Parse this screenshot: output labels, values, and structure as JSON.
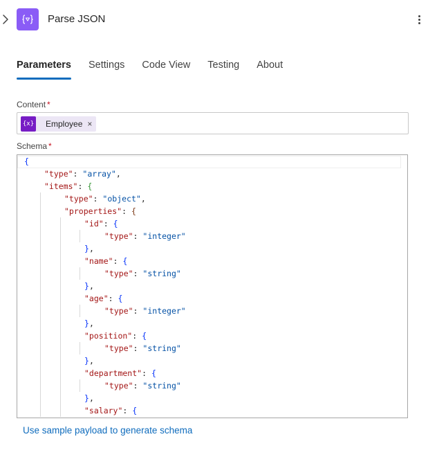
{
  "header": {
    "title": "Parse JSON",
    "icon_text": "{ }"
  },
  "tabs": [
    {
      "label": "Parameters",
      "active": true
    },
    {
      "label": "Settings",
      "active": false
    },
    {
      "label": "Code View",
      "active": false
    },
    {
      "label": "Testing",
      "active": false
    },
    {
      "label": "About",
      "active": false
    }
  ],
  "content": {
    "label": "Content",
    "required_mark": "*",
    "token": {
      "label": "Employee",
      "icon_text": "{x}",
      "remove_glyph": "×"
    }
  },
  "schema": {
    "label": "Schema",
    "required_mark": "*",
    "lines": [
      "{",
      "\"type\": \"array\",",
      "\"items\": {",
      "\"type\": \"object\",",
      "\"properties\": {",
      "\"id\": {",
      "\"type\": \"integer\"",
      "},",
      "\"name\": {",
      "\"type\": \"string\"",
      "},",
      "\"age\": {",
      "\"type\": \"integer\"",
      "},",
      "\"position\": {",
      "\"type\": \"string\"",
      "},",
      "\"department\": {",
      "\"type\": \"string\"",
      "},",
      "\"salary\": {"
    ]
  },
  "sample_link": "Use sample payload to generate schema",
  "colors": {
    "accent": "#0f6cbd",
    "action_icon": "#8a5cf6",
    "token_icon": "#771dc5",
    "required": "#c50f1f"
  },
  "icons": {
    "collapse": "chevron-right-icon",
    "action": "parse-json-icon",
    "more": "more-vertical-icon",
    "token": "variable-icon"
  }
}
